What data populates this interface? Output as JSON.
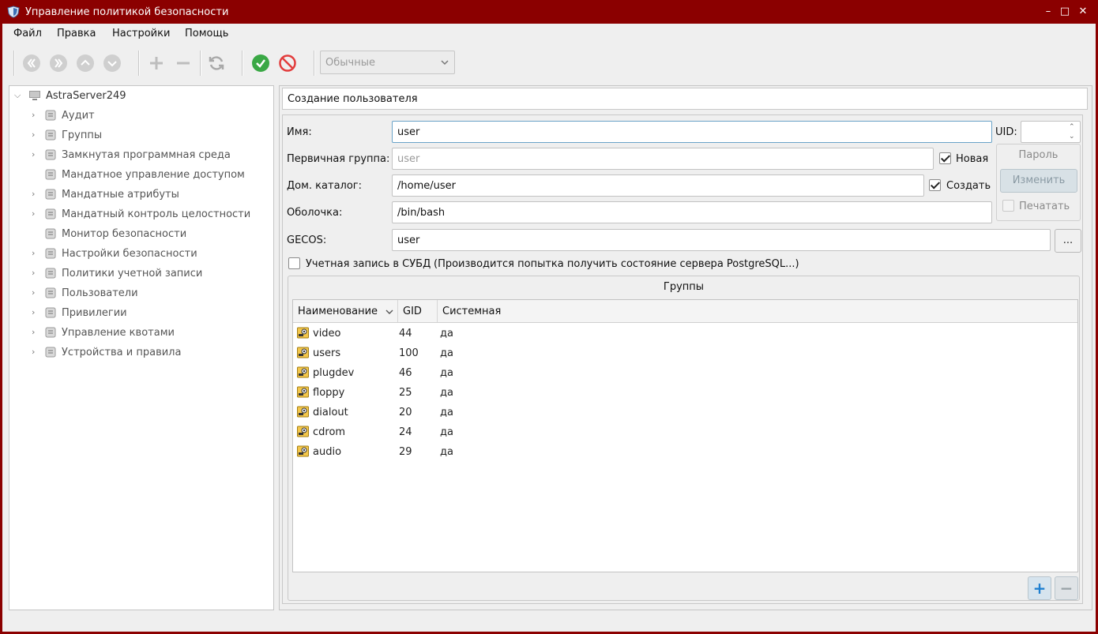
{
  "window": {
    "title": "Управление политикой безопасности",
    "controls": {
      "minimize": "–",
      "maximize": "□",
      "close": "✕"
    }
  },
  "menu": [
    "Файл",
    "Правка",
    "Настройки",
    "Помощь"
  ],
  "toolbar": {
    "buttons": [
      "first-icon",
      "last-icon",
      "up-icon",
      "down-icon",
      "add-icon",
      "remove-icon",
      "refresh-icon",
      "apply-icon",
      "cancel-icon"
    ],
    "mode_select": "Обычные"
  },
  "tree": {
    "root": "AstraServer249",
    "items": [
      {
        "label": "Аудит",
        "icon": "audit-icon",
        "expandable": true
      },
      {
        "label": "Группы",
        "icon": "groups-icon",
        "expandable": true
      },
      {
        "label": "Замкнутая программная среда",
        "icon": "closed-env-icon",
        "expandable": true
      },
      {
        "label": "Мандатное управление доступом",
        "icon": "mandatory-access-icon",
        "expandable": false
      },
      {
        "label": "Мандатные атрибуты",
        "icon": "mandatory-attrs-icon",
        "expandable": true
      },
      {
        "label": "Мандатный контроль целостности",
        "icon": "integrity-icon",
        "expandable": true
      },
      {
        "label": "Монитор безопасности",
        "icon": "monitor-icon",
        "expandable": false
      },
      {
        "label": "Настройки безопасности",
        "icon": "security-settings-icon",
        "expandable": true
      },
      {
        "label": "Политики учетной записи",
        "icon": "account-policy-icon",
        "expandable": true
      },
      {
        "label": "Пользователи",
        "icon": "users-icon",
        "expandable": true
      },
      {
        "label": "Привилегии",
        "icon": "privileges-icon",
        "expandable": true
      },
      {
        "label": "Управление квотами",
        "icon": "quota-icon",
        "expandable": true
      },
      {
        "label": "Устройства и правила",
        "icon": "devices-icon",
        "expandable": true
      }
    ]
  },
  "panel": {
    "header": "Создание пользователя",
    "name_label": "Имя:",
    "name_value": "user",
    "uid_label": "UID:",
    "uid_value": "",
    "primary_group_label": "Первичная группа:",
    "primary_group_value": "user",
    "new_label": "Новая",
    "new_checked": true,
    "home_label": "Дом. каталог:",
    "home_value": "/home/user",
    "create_label": "Создать",
    "create_checked": true,
    "shell_label": "Оболочка:",
    "shell_value": "/bin/bash",
    "gecos_label": "GECOS:",
    "gecos_value": "user",
    "gecos_btn": "...",
    "password_title": "Пароль",
    "change_btn": "Изменить",
    "print_label": "Печатать",
    "print_checked": false,
    "dbms_label": "Учетная запись в СУБД",
    "dbms_status": "(Производится попытка получить состояние сервера PostgreSQL...)",
    "dbms_checked": false
  },
  "groups": {
    "title": "Группы",
    "columns": [
      "Наименование",
      "GID",
      "Системная"
    ],
    "rows": [
      {
        "name": "video",
        "gid": "44",
        "system": "да"
      },
      {
        "name": "users",
        "gid": "100",
        "system": "да"
      },
      {
        "name": "plugdev",
        "gid": "46",
        "system": "да"
      },
      {
        "name": "floppy",
        "gid": "25",
        "system": "да"
      },
      {
        "name": "dialout",
        "gid": "20",
        "system": "да"
      },
      {
        "name": "cdrom",
        "gid": "24",
        "system": "да"
      },
      {
        "name": "audio",
        "gid": "29",
        "system": "да"
      }
    ],
    "add_btn": "+",
    "remove_btn": "−"
  },
  "colors": {
    "titlebar": "#8b0000",
    "accent": "#1e7fd0",
    "apply": "#3aa845",
    "cancel": "#e23c3c"
  }
}
